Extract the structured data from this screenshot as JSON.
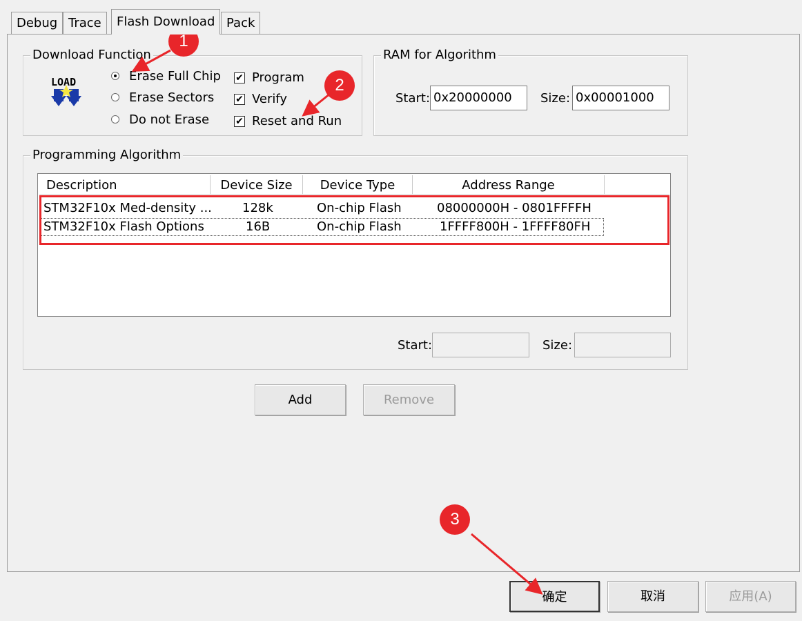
{
  "tabs": [
    {
      "label": "Debug",
      "active": false
    },
    {
      "label": "Trace",
      "active": false
    },
    {
      "label": "Flash Download",
      "active": true
    },
    {
      "label": "Pack",
      "active": false
    }
  ],
  "download_function": {
    "title": "Download Function",
    "icon": "load-icon",
    "icon_text": "LOAD",
    "erase_options": [
      {
        "label": "Erase Full Chip",
        "selected": true
      },
      {
        "label": "Erase Sectors",
        "selected": false
      },
      {
        "label": "Do not Erase",
        "selected": false
      }
    ],
    "checks": [
      {
        "label": "Program",
        "checked": true
      },
      {
        "label": "Verify",
        "checked": true
      },
      {
        "label": "Reset and Run",
        "checked": true
      }
    ]
  },
  "ram_for_algorithm": {
    "title": "RAM for Algorithm",
    "start_label": "Start:",
    "start_value": "0x20000000",
    "size_label": "Size:",
    "size_value": "0x00001000"
  },
  "programming_algorithm": {
    "title": "Programming Algorithm",
    "columns": [
      "Description",
      "Device Size",
      "Device Type",
      "Address Range"
    ],
    "rows": [
      {
        "description": "STM32F10x Med-density ...",
        "size": "128k",
        "type": "On-chip Flash",
        "range": "08000000H - 0801FFFFH"
      },
      {
        "description": "STM32F10x Flash Options",
        "size": "16B",
        "type": "On-chip Flash",
        "range": "1FFFF800H - 1FFFF80FH"
      }
    ],
    "start_label": "Start:",
    "start_value": "",
    "size_label": "Size:",
    "size_value": ""
  },
  "buttons": {
    "add": "Add",
    "remove": "Remove",
    "ok": "确定",
    "cancel": "取消",
    "apply": "应用(A)"
  },
  "annotations": {
    "badge1": "1",
    "badge2": "2",
    "badge3": "3",
    "color": "#e8262a"
  }
}
